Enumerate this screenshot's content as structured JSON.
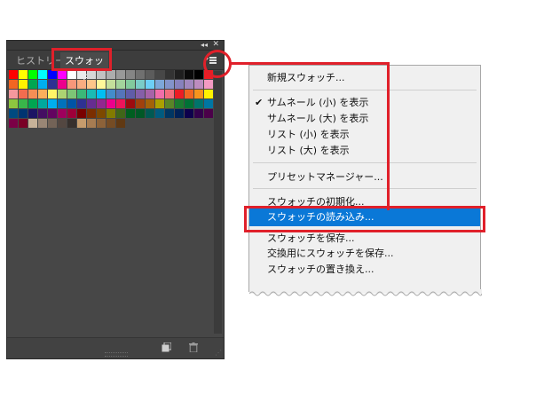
{
  "panel": {
    "tabs": [
      {
        "label": "ヒストリー",
        "active": false
      },
      {
        "label": "スウォッチ",
        "active": true
      }
    ],
    "collapse_label": "◂◂",
    "close_label": "✕",
    "swatch_rows": [
      [
        "#ff0000",
        "#ffff00",
        "#00ff00",
        "#00ffff",
        "#0000ff",
        "#ff00ff",
        "#ffffff",
        "#ebebeb",
        "#d6d6d6",
        "#c2c2c2",
        "#adadad",
        "#999999",
        "#858585",
        "#707070",
        "#5c5c5c",
        "#474747",
        "#333333",
        "#1f1f1f",
        "#0a0a0a",
        "#000000"
      ],
      [
        "#ed1c24",
        "#f26522",
        "#fff200",
        "#00a651",
        "#00aeef",
        "#2e3192",
        "#ec008c",
        "#f7977a",
        "#f9ad81",
        "#fdc68a",
        "#fff79a",
        "#c4df9b",
        "#a3d39c",
        "#82ca9d",
        "#7accc8",
        "#6dcff6",
        "#7da7d9",
        "#8393ca",
        "#8781bd",
        "#a187be"
      ],
      [
        "#bd8cbf",
        "#f49ac2",
        "#f6989d",
        "#f26c4f",
        "#f68e55",
        "#fbaf5c",
        "#fff467",
        "#acd372",
        "#7cc576",
        "#3bb878",
        "#1abbb4",
        "#00bff3",
        "#438ccb",
        "#5574b9",
        "#605ca8",
        "#855fa8",
        "#a763a8",
        "#f06eaa",
        "#f26d7d",
        "#ed1c24"
      ],
      [
        "#f26522",
        "#f7941d",
        "#fff200",
        "#8dc63f",
        "#39b54a",
        "#00a651",
        "#00a99d",
        "#00aeef",
        "#0072bc",
        "#0054a6",
        "#2e3192",
        "#662d91",
        "#92278f",
        "#ec008c",
        "#ed145b",
        "#9e0b0f",
        "#a0410d",
        "#a36209",
        "#aba000",
        "#598527"
      ],
      [
        "#1a7b30",
        "#007236",
        "#00746b",
        "#0076a3",
        "#004a80",
        "#003471",
        "#1b1464",
        "#440e62",
        "#630460",
        "#9e005d",
        "#9e0039",
        "#790000",
        "#7b2e00",
        "#7d4900",
        "#827b00",
        "#406618",
        "#005e20",
        "#005826",
        "#005952",
        "#005b7f"
      ],
      [
        "#003663",
        "#002157",
        "#0d004c",
        "#32004b",
        "#4b0049",
        "#7b0046",
        "#7a0026",
        "#c7b299",
        "#998675",
        "#736357",
        "#534741",
        "#37302d",
        "#c69c6d",
        "#a67c52",
        "#8c6239",
        "#754c24",
        "#603913"
      ]
    ]
  },
  "menu": {
    "items": [
      {
        "label": "新規スウォッチ...",
        "checked": false
      },
      {
        "label": "サムネール (小) を表示",
        "checked": true
      },
      {
        "label": "サムネール (大) を表示",
        "checked": false
      },
      {
        "label": "リスト (小) を表示",
        "checked": false
      },
      {
        "label": "リスト (大) を表示",
        "checked": false
      },
      {
        "label": "プリセットマネージャー...",
        "checked": false
      },
      {
        "label": "スウォッチの初期化...",
        "checked": false
      },
      {
        "label": "スウォッチの読み込み...",
        "checked": false,
        "highlighted": true
      },
      {
        "label": "スウォッチを保存...",
        "checked": false
      },
      {
        "label": "交換用にスウォッチを保存...",
        "checked": false
      },
      {
        "label": "スウォッチの置き換え...",
        "checked": false
      }
    ],
    "check_mark": "✔"
  },
  "colors": {
    "annotation_red": "#e0202a",
    "menu_highlight": "#0a78d7",
    "panel_bg": "#474747"
  }
}
